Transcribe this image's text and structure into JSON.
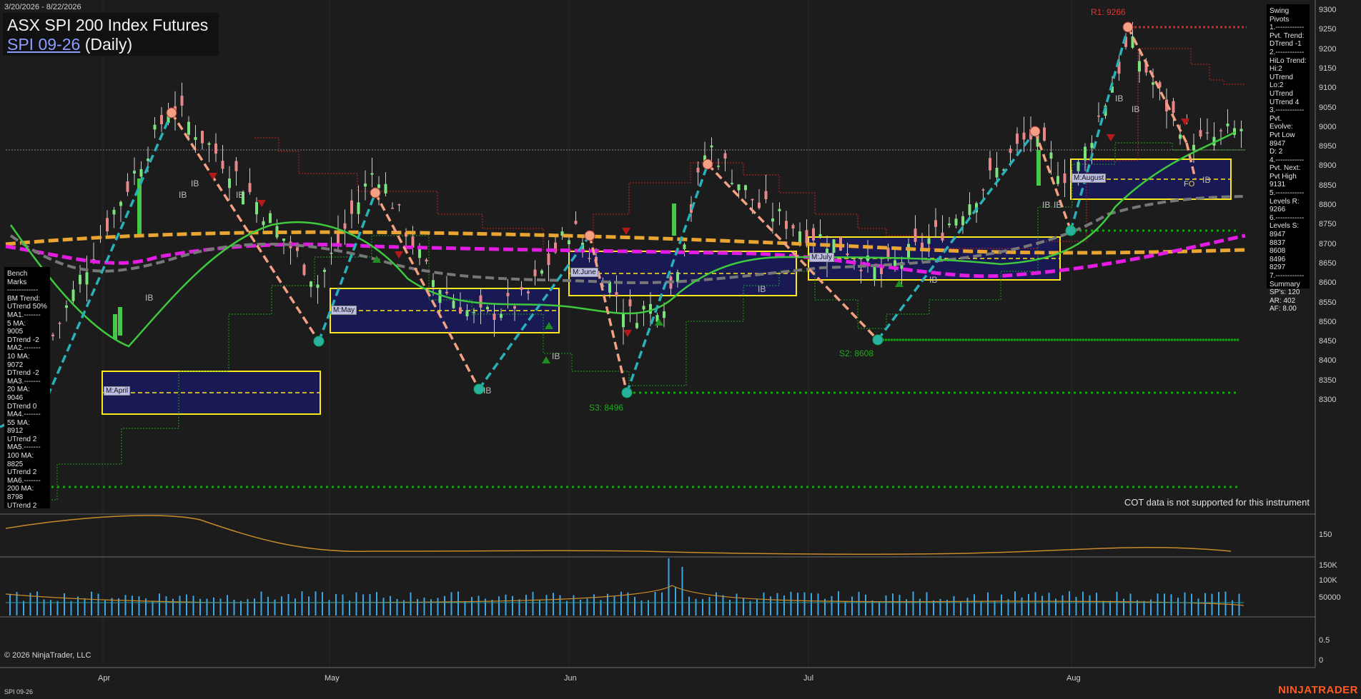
{
  "header": {
    "date_range": "3/20/2026 - 8/22/2026",
    "title": "ASX SPI 200 Index Futures",
    "symbol": "SPI 09-26",
    "interval": "(Daily)"
  },
  "bench_marks": {
    "lines": [
      "Bench Marks",
      "-------------",
      "BM Trend:",
      "UTrend 50%",
      "MA1.-------",
      "5 MA:",
      "9005",
      "DTrend -2",
      "MA2.-------",
      "10 MA:",
      "9072",
      "DTrend -2",
      "MA3.-------",
      "20 MA:",
      "9046",
      "DTrend 0",
      "MA4.-------",
      "55 MA:",
      "8912",
      "UTrend 2",
      "MA5.-------",
      "100 MA:",
      "8825",
      "UTrend 2",
      "MA6.-------",
      "200 MA:",
      "8798",
      "UTrend 2"
    ]
  },
  "swing_pivots": {
    "lines": [
      "Swing Pivots",
      "1.------------",
      "Pvt. Trend:",
      "DTrend -1",
      "2.------------",
      "HiLo Trend:",
      "Hi:2 UTrend",
      "Lo:2 UTrend",
      "UTrend 4",
      "3.------------",
      "Pvt. Evolve:",
      "Pvt Low",
      "8947",
      "D: 2",
      "4.------------",
      "Pvt. Next:",
      "Pvt High",
      "9131",
      "5.------------",
      "Levels R:",
      "9266",
      "6.------------",
      "Levels S:",
      "8947",
      "8837",
      "8608",
      "8496",
      "8297",
      "7.------------",
      "Summary",
      "SP's: 120",
      "AR: 402",
      "AF: 8.00"
    ]
  },
  "price_axis": [
    "9300",
    "9250",
    "9200",
    "9150",
    "9100",
    "9050",
    "9000",
    "8950",
    "8900",
    "8850",
    "8800",
    "8750",
    "8700",
    "8650",
    "8600",
    "8550",
    "8500",
    "8450",
    "8400",
    "8350",
    "8300"
  ],
  "indicator_axis": [
    "150"
  ],
  "volume_axis": [
    "150K",
    "100K",
    "50000"
  ],
  "lower_axis": [
    "0.5",
    "0"
  ],
  "time_axis": [
    "Apr",
    "May",
    "Jun",
    "Jul",
    "Aug"
  ],
  "levels": {
    "r1": "R1: 9266",
    "s2": "S2: 8608",
    "s3": "S3: 8496"
  },
  "box_labels": [
    "M:April",
    "M:May",
    "M:June",
    "M:July",
    "M:August"
  ],
  "ib_labels": [
    "IB",
    "IB",
    "IB",
    "IB",
    "IB",
    "IB",
    "IB",
    "IB",
    "IB",
    "IB",
    "IB",
    "IB",
    "IB"
  ],
  "fo_label": "FO",
  "cot_note": "COT data is not supported for this instrument",
  "copyright": "© 2026 NinjaTrader, LLC",
  "instrument_footer": "SPI 09-26",
  "brand": "NINJATRADER",
  "colors": {
    "background": "#1c1c1c",
    "swing_up": "#2ab0b8",
    "swing_down": "#f4a082",
    "ma_green": "#3ec93e",
    "ma_orange": "#e8a531",
    "ma_magenta": "#e21ce2",
    "ma_gray": "#777777",
    "box_fill": "#1a1a5a",
    "box_border": "#ffe81a",
    "resistance": "#dd2222",
    "support": "#1f9f1f",
    "brand": "#ff5a1f"
  }
}
